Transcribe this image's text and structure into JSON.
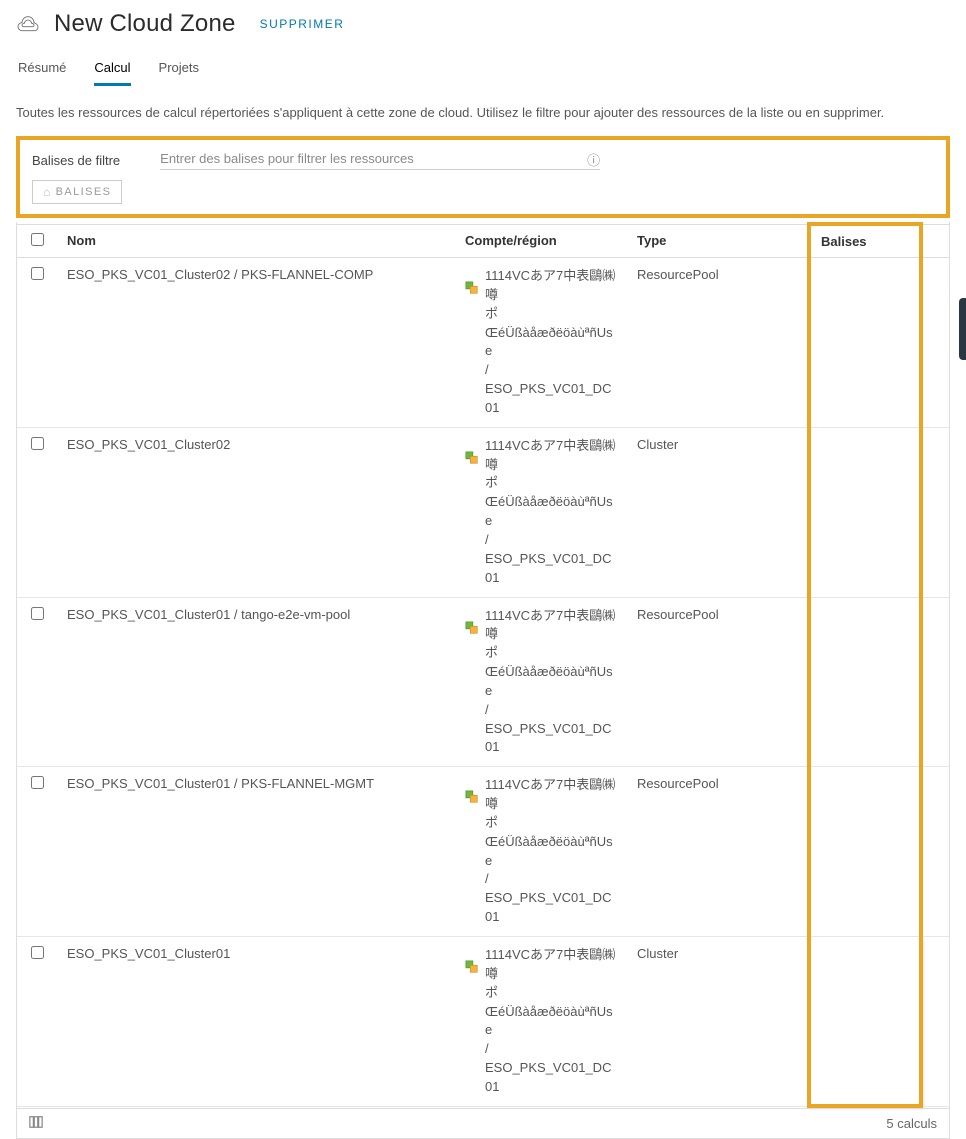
{
  "header": {
    "title": "New Cloud Zone",
    "delete_label": "SUPPRIMER"
  },
  "tabs": [
    {
      "label": "Résumé",
      "active": false
    },
    {
      "label": "Calcul",
      "active": true
    },
    {
      "label": "Projets",
      "active": false
    }
  ],
  "description": "Toutes les ressources de calcul répertoriées s'appliquent à cette zone de cloud. Utilisez le filtre pour ajouter des ressources de la liste ou en supprimer.",
  "filter": {
    "label": "Balises de filtre",
    "placeholder": "Entrer des balises pour filtrer les ressources",
    "button_label": "BALISES"
  },
  "table": {
    "columns": {
      "name": "Nom",
      "account": "Compte/région",
      "type": "Type",
      "tags": "Balises"
    },
    "rows": [
      {
        "name": "ESO_PKS_VC01_Cluster02 / PKS-FLANNEL-COMP",
        "account_line1": "1114VCあア7中表鷗㈱噂",
        "account_line2": "ポ",
        "account_line3": "ŒéÜßàåæðëöàùªñUse",
        "account_line4": "/",
        "account_line5": "ESO_PKS_VC01_DC01",
        "type": "ResourcePool",
        "tags": ""
      },
      {
        "name": "ESO_PKS_VC01_Cluster02",
        "account_line1": "1114VCあア7中表鷗㈱噂",
        "account_line2": "ポ",
        "account_line3": "ŒéÜßàåæðëöàùªñUse",
        "account_line4": "/",
        "account_line5": "ESO_PKS_VC01_DC01",
        "type": "Cluster",
        "tags": ""
      },
      {
        "name": "ESO_PKS_VC01_Cluster01 / tango-e2e-vm-pool",
        "account_line1": "1114VCあア7中表鷗㈱噂",
        "account_line2": "ポ",
        "account_line3": "ŒéÜßàåæðëöàùªñUse",
        "account_line4": "/",
        "account_line5": "ESO_PKS_VC01_DC01",
        "type": "ResourcePool",
        "tags": ""
      },
      {
        "name": "ESO_PKS_VC01_Cluster01 / PKS-FLANNEL-MGMT",
        "account_line1": "1114VCあア7中表鷗㈱噂",
        "account_line2": "ポ",
        "account_line3": "ŒéÜßàåæðëöàùªñUse",
        "account_line4": "/",
        "account_line5": "ESO_PKS_VC01_DC01",
        "type": "ResourcePool",
        "tags": ""
      },
      {
        "name": "ESO_PKS_VC01_Cluster01",
        "account_line1": "1114VCあア7中表鷗㈱噂",
        "account_line2": "ポ",
        "account_line3": "ŒéÜßàåæðëöàùªñUse",
        "account_line4": "/",
        "account_line5": "ESO_PKS_VC01_DC01",
        "type": "Cluster",
        "tags": ""
      }
    ],
    "footer_count": "5 calculs"
  }
}
